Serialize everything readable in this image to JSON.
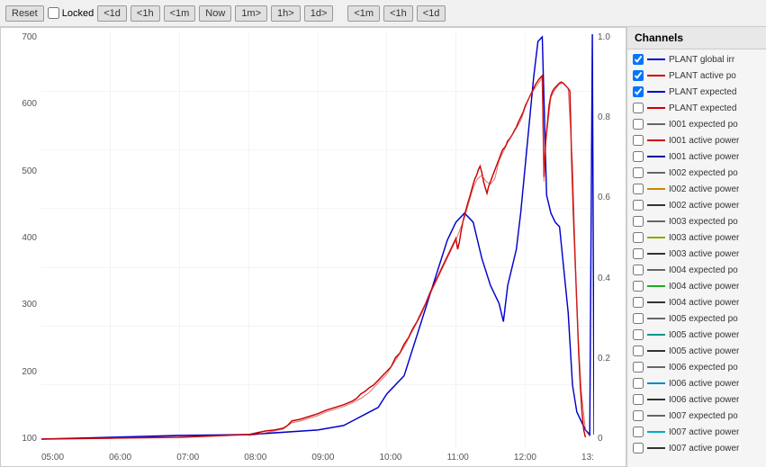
{
  "toolbar": {
    "reset_label": "Reset",
    "locked_label": "Locked",
    "buttons": [
      "<1d",
      "<1h",
      "<1m",
      "Now",
      "1m>",
      "1h>",
      "1d>",
      "<1m",
      "<1h",
      "<1d"
    ]
  },
  "chart": {
    "y_axis_left": [
      "700",
      "600",
      "500",
      "400",
      "300",
      "200",
      "100"
    ],
    "y_axis_right": [
      "1.0",
      "0.8",
      "0.6",
      "0.4",
      "0.2",
      "0"
    ],
    "x_axis": [
      "05:00",
      "06:00",
      "07:00",
      "08:00",
      "09:00",
      "10:00",
      "11:00",
      "12:00",
      "13:"
    ]
  },
  "channels": {
    "header": "Channels",
    "items": [
      {
        "label": "PLANT global irr",
        "color": "#0000cc",
        "checked": true
      },
      {
        "label": "PLANT active po",
        "color": "#cc0000",
        "checked": true
      },
      {
        "label": "PLANT expected",
        "color": "#0000cc",
        "checked": true
      },
      {
        "label": "PLANT expected",
        "color": "#cc0000",
        "checked": false
      },
      {
        "label": "I001 expected po",
        "color": "#666666",
        "checked": false
      },
      {
        "label": "I001 active power",
        "color": "#cc0000",
        "checked": false
      },
      {
        "label": "I001 active power",
        "color": "#000099",
        "checked": false
      },
      {
        "label": "I002 expected po",
        "color": "#666666",
        "checked": false
      },
      {
        "label": "I002 active power",
        "color": "#cc8800",
        "checked": false
      },
      {
        "label": "I002 active power",
        "color": "#333333",
        "checked": false
      },
      {
        "label": "I003 expected po",
        "color": "#666666",
        "checked": false
      },
      {
        "label": "I003 active power",
        "color": "#88aa00",
        "checked": false
      },
      {
        "label": "I003 active power",
        "color": "#333333",
        "checked": false
      },
      {
        "label": "I004 expected po",
        "color": "#666666",
        "checked": false
      },
      {
        "label": "I004 active power",
        "color": "#22aa22",
        "checked": false
      },
      {
        "label": "I004 active power",
        "color": "#333333",
        "checked": false
      },
      {
        "label": "I005 expected po",
        "color": "#666666",
        "checked": false
      },
      {
        "label": "I005 active power",
        "color": "#009988",
        "checked": false
      },
      {
        "label": "I005 active power",
        "color": "#333333",
        "checked": false
      },
      {
        "label": "I006 expected po",
        "color": "#666666",
        "checked": false
      },
      {
        "label": "I006 active power",
        "color": "#0088cc",
        "checked": false
      },
      {
        "label": "I006 active power",
        "color": "#333333",
        "checked": false
      },
      {
        "label": "I007 expected po",
        "color": "#666666",
        "checked": false
      },
      {
        "label": "I007 active power",
        "color": "#00aacc",
        "checked": false
      },
      {
        "label": "I007 active power",
        "color": "#333333",
        "checked": false
      }
    ]
  }
}
